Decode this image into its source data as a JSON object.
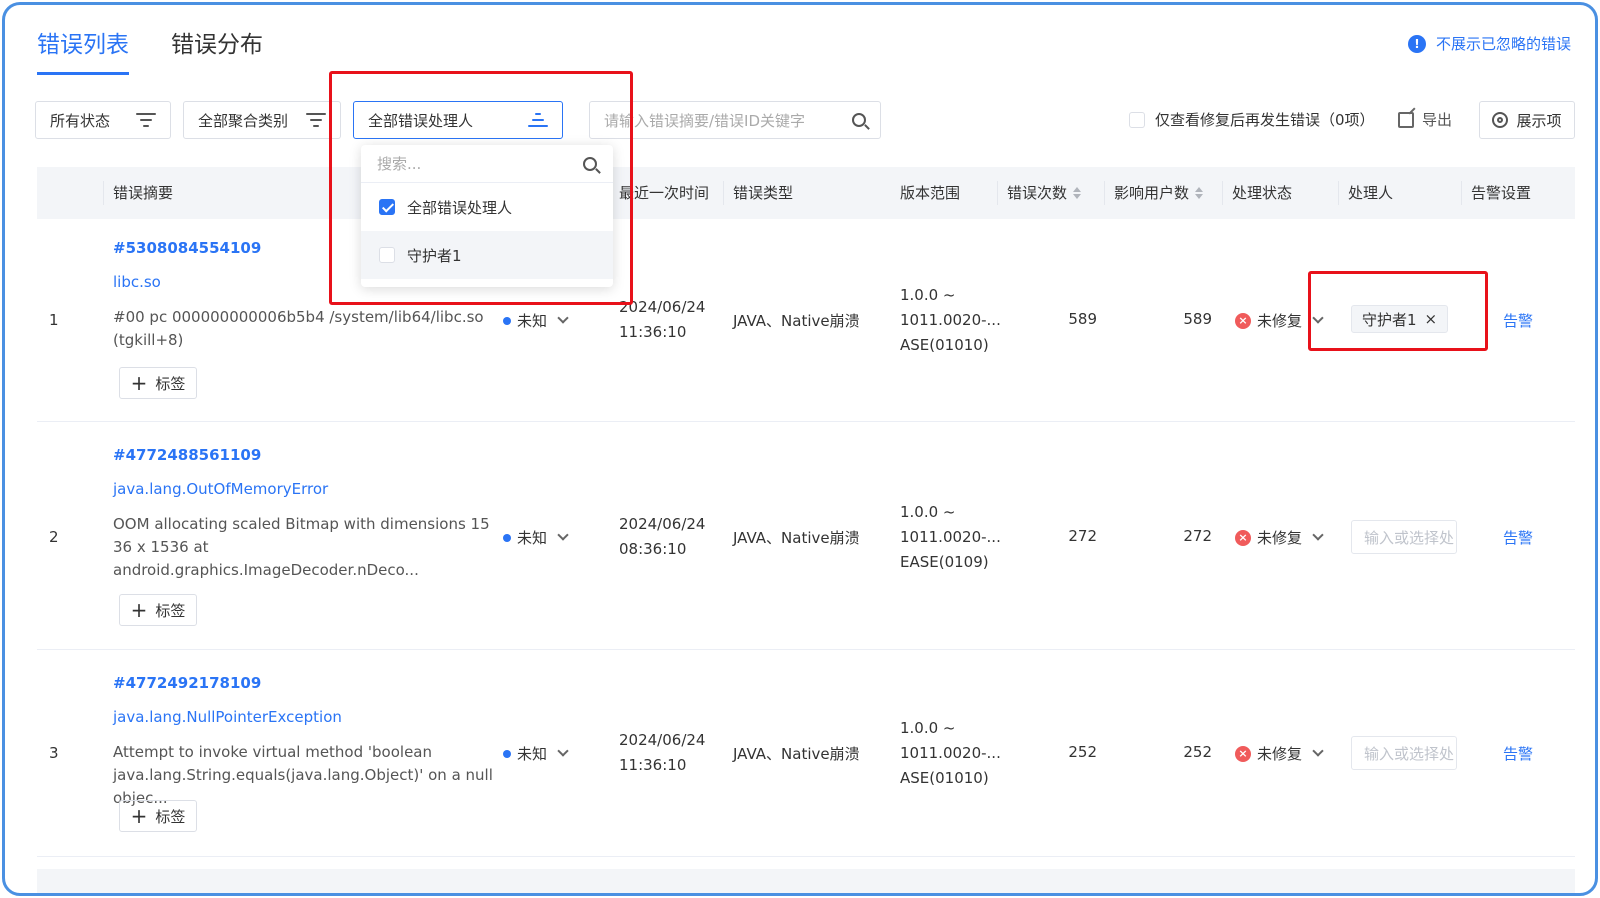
{
  "tabs": [
    {
      "label": "错误列表"
    },
    {
      "label": "错误分布"
    }
  ],
  "hide_ignored_label": "不展示已忽略的错误",
  "filters": {
    "status_label": "所有状态",
    "category_label": "全部聚合类别",
    "handler_label": "全部错误处理人",
    "search_placeholder": "请输入错误摘要/错误ID关键字"
  },
  "only_fixed_label": "仅查看修复后再发生错误（0项）",
  "export_label": "导出",
  "display_label": "展示项",
  "columns": [
    "错误摘要",
    "最近一次时间",
    "错误类型",
    "版本范围",
    "错误次数",
    "影响用户数",
    "处理状态",
    "处理人",
    "告警设置"
  ],
  "dropdown": {
    "search_placeholder": "搜索...",
    "options": [
      {
        "label": "全部错误处理人",
        "checked": true
      },
      {
        "label": "守护者1",
        "checked": false
      }
    ]
  },
  "rows": [
    {
      "index": "1",
      "id": "#5308084554109",
      "link": "libc.so",
      "desc": "#00 pc 000000000006b5b4 /system/lib64/libc.so (tgkill+8)",
      "level": "未知",
      "time_date": "2024/06/24",
      "time_clock": "11:36:10",
      "type": "JAVA、Native崩溃",
      "ver_1": "1.0.0 ~",
      "ver_2": "1011.0020-...",
      "ver_3": "ASE(01010)",
      "count": "589",
      "users": "589",
      "status": "未修复",
      "handler": "守护者1",
      "alert": "告警",
      "tag": "标签"
    },
    {
      "index": "2",
      "id": "#4772488561109",
      "link": "java.lang.OutOfMemoryError",
      "desc": "OOM allocating scaled Bitmap with dimensions 15 36 x 1536 at android.graphics.ImageDecoder.nDeco...",
      "level": "未知",
      "time_date": "2024/06/24",
      "time_clock": "08:36:10",
      "type": "JAVA、Native崩溃",
      "ver_1": "1.0.0 ~",
      "ver_2": "1011.0020-...",
      "ver_3": "EASE(0109)",
      "count": "272",
      "users": "272",
      "status": "未修复",
      "handler_placeholder": "输入或选择处",
      "alert": "告警",
      "tag": "标签"
    },
    {
      "index": "3",
      "id": "#4772492178109",
      "link": "java.lang.NullPointerException",
      "desc": "Attempt to invoke virtual method 'boolean java.lang.String.equals(java.lang.Object)' on a null objec...",
      "level": "未知",
      "time_date": "2024/06/24",
      "time_clock": "11:36:10",
      "type": "JAVA、Native崩溃",
      "ver_1": "1.0.0 ~",
      "ver_2": "1011.0020-...",
      "ver_3": "ASE(01010)",
      "count": "252",
      "users": "252",
      "status": "未修复",
      "handler_placeholder": "输入或选择处",
      "alert": "告警",
      "tag": "标签"
    }
  ],
  "colors": {
    "accent": "#2a74f5",
    "highlight": "#e8111a",
    "danger": "#f05b5b"
  }
}
